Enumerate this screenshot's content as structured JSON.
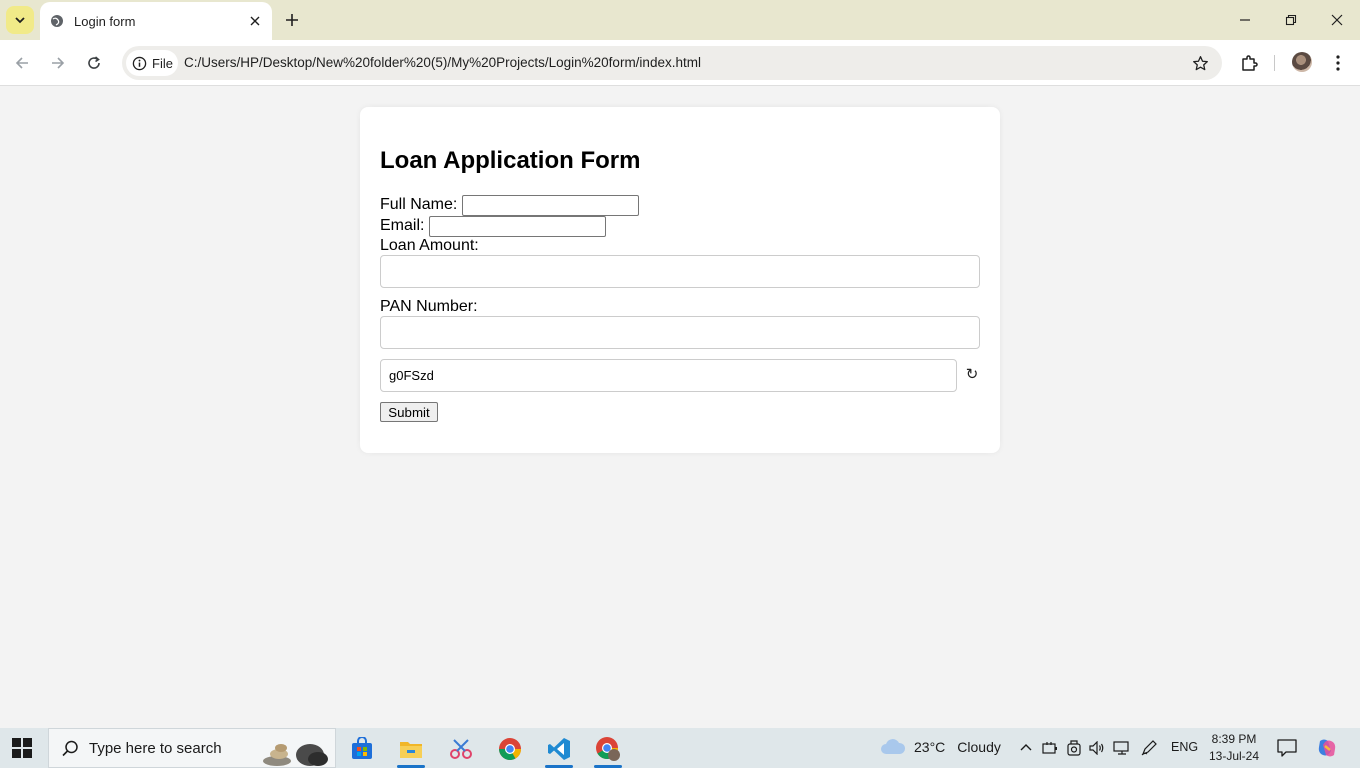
{
  "browser": {
    "tab_title": "Login form",
    "chip_label": "File",
    "url": "C:/Users/HP/Desktop/New%20folder%20(5)/My%20Projects/Login%20form/index.html"
  },
  "form": {
    "title": "Loan Application Form",
    "full_name_label": "Full Name:",
    "email_label": "Email:",
    "loan_amount_label": "Loan Amount:",
    "pan_label": "PAN Number:",
    "captcha_value": "g0FSzd",
    "refresh_glyph": "↻",
    "submit_label": "Submit"
  },
  "taskbar": {
    "search_placeholder": "Type here to search",
    "weather_temp": "23°C",
    "weather_condition": "Cloudy",
    "language": "ENG",
    "time": "8:39 PM",
    "date": "13-Jul-24"
  },
  "icons": [
    "chevron-down-icon",
    "globe-icon",
    "close-icon",
    "plus-icon",
    "minimize-icon",
    "restore-icon",
    "back-icon",
    "forward-icon",
    "reload-icon",
    "info-icon",
    "star-icon",
    "extensions-icon",
    "profile-avatar",
    "more-icon",
    "refresh-icon",
    "windows-start-icon",
    "search-icon",
    "store-icon",
    "file-explorer-icon",
    "snipping-tool-icon",
    "chrome-icon",
    "vscode-icon",
    "cloud-icon",
    "chevron-up-icon",
    "notification-icon",
    "copilot-icon"
  ]
}
